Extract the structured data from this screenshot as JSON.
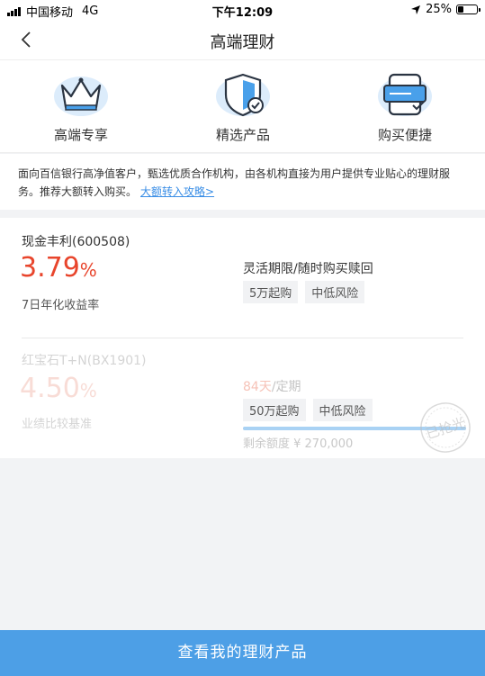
{
  "status_bar": {
    "carrier": "中国移动",
    "network": "4G",
    "time": "下午12:09",
    "battery": "25%"
  },
  "nav": {
    "title": "高端理财"
  },
  "features": [
    {
      "label": "高端专享",
      "icon": "crown-icon"
    },
    {
      "label": "精选产品",
      "icon": "shield-icon"
    },
    {
      "label": "购买便捷",
      "icon": "card-icon"
    }
  ],
  "intro": {
    "text": "面向百信银行高净值客户，甄选优质合作机构，由各机构直接为用户提供专业贴心的理财服务。推荐大额转入购买。",
    "link": "大额转入攻略>"
  },
  "products": [
    {
      "name": "现金丰利(600508)",
      "rate": "3.79",
      "rate_unit": "%",
      "rate_label": "7日年化收益率",
      "desc": "灵活期限/随时购买赎回",
      "tags": [
        "5万起购",
        "中低风险"
      ]
    },
    {
      "name": "红宝石T+N(BX1901)",
      "rate": "4.50",
      "rate_unit": "%",
      "rate_label": "业绩比较基准",
      "desc_days": "84天",
      "desc_suffix": "/定期",
      "tags": [
        "50万起购",
        "中低风险"
      ],
      "remaining": "剩余额度 ¥ 270,000",
      "progress": 1.0,
      "stamp": "已抢光"
    }
  ],
  "cta": {
    "label": "查看我的理财产品"
  },
  "colors": {
    "accent": "#4d9fe6",
    "rate_red": "#e8452c",
    "link": "#3a8ee6"
  }
}
